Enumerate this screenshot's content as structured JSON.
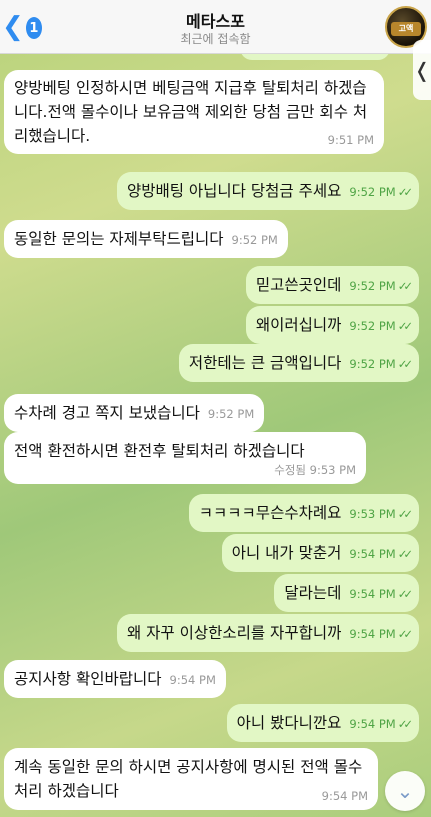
{
  "header": {
    "back_count": "1",
    "title": "메타스포",
    "subtitle": "최근에 접속함",
    "avatar_text": "고액"
  },
  "messages": [
    {
      "text": "양방베팅 인정하시면 베팅금액 지급후 탈퇴처리 하겠습니다.전액 몰수이나 보유금액 제외한 당첨 금만 회수 처리했습니다.",
      "time": "9:51 PM"
    },
    {
      "text": "양방배팅 아닙니다 당첨금 주세요",
      "time": "9:52 PM"
    },
    {
      "text": "동일한 문의는 자제부탁드립니다",
      "time": "9:52 PM"
    },
    {
      "text": "믿고쓴곳인데",
      "time": "9:52 PM"
    },
    {
      "text": "왜이러십니까",
      "time": "9:52 PM"
    },
    {
      "text": "저한테는 큰 금액입니다",
      "time": "9:52 PM"
    },
    {
      "text": "수차례 경고 쪽지 보냈습니다",
      "time": "9:52 PM"
    },
    {
      "text": "전액 환전하시면 환전후 탈퇴처리 하겠습니다",
      "time": "수정됨 9:53 PM"
    },
    {
      "text": "ㅋㅋㅋㅋ무슨수차례요",
      "time": "9:53 PM"
    },
    {
      "text": "아니 내가 맞춘거",
      "time": "9:54 PM"
    },
    {
      "text": "달라는데",
      "time": "9:54 PM"
    },
    {
      "text": "왜 자꾸 이상한소리를 자꾸합니까",
      "time": "9:54 PM"
    },
    {
      "text": "공지사항 확인바랍니다",
      "time": "9:54 PM"
    },
    {
      "text": "아니 봤다니깐요",
      "time": "9:54 PM"
    },
    {
      "text": "계속 동일한 문의 하시면 공지사항에 명시된 전액 몰수 처리 하겠습니다",
      "time": "9:54 PM"
    }
  ],
  "colors": {
    "incoming": "#ffffff",
    "outgoing": "#e2f7c5",
    "accent": "#2f8cf0",
    "read_check": "#4fa445"
  },
  "icons": {
    "back": "chevron-left-icon",
    "read": "double-check-icon",
    "scroll": "chevron-down-icon"
  }
}
